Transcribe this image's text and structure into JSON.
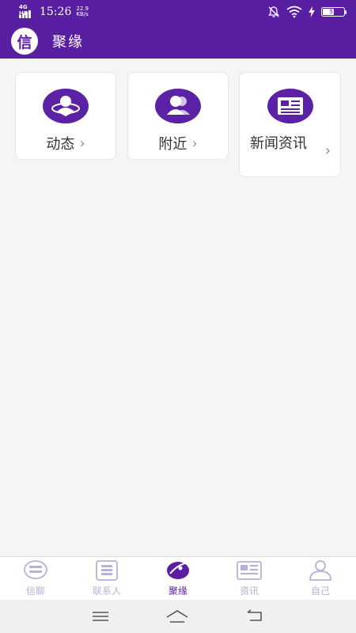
{
  "status_bar": {
    "network": "4G HD",
    "time": "15:26",
    "speed_value": "22.9",
    "speed_unit": "KB/s",
    "battery_level": "51"
  },
  "app_bar": {
    "logo_char": "信",
    "title": "聚缘"
  },
  "cards": [
    {
      "label": "动态",
      "icon": "moments-icon"
    },
    {
      "label": "附近",
      "icon": "nearby-people-icon"
    },
    {
      "label": "新闻资讯",
      "icon": "news-icon"
    }
  ],
  "tabs": [
    {
      "label": "信聊",
      "icon": "chat-icon",
      "active": false
    },
    {
      "label": "联系人",
      "icon": "contacts-icon",
      "active": false
    },
    {
      "label": "聚缘",
      "icon": "discover-icon",
      "active": true
    },
    {
      "label": "资讯",
      "icon": "news-icon",
      "active": false
    },
    {
      "label": "自己",
      "icon": "profile-icon",
      "active": false
    }
  ],
  "colors": {
    "primary": "#5a1ea2",
    "inactive_tab": "#b9afd8",
    "background": "#f5f5f5"
  }
}
